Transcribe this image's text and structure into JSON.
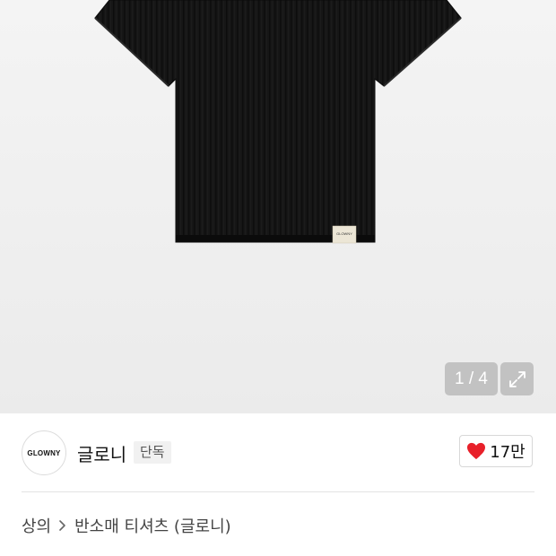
{
  "gallery": {
    "counter": "1 / 4",
    "label_text": "GLOWNY",
    "expand_icon": "expand-arrows-icon"
  },
  "brand": {
    "logo_text": "GLOWNY",
    "name": "글로니",
    "badge": "단독"
  },
  "like": {
    "icon": "heart-icon",
    "color": "#e8202a",
    "count": "17만"
  },
  "breadcrumb": {
    "category": "상의",
    "separator_icon": "chevron-right-icon",
    "subcategory": "반소매 티셔츠 (글로니)"
  }
}
